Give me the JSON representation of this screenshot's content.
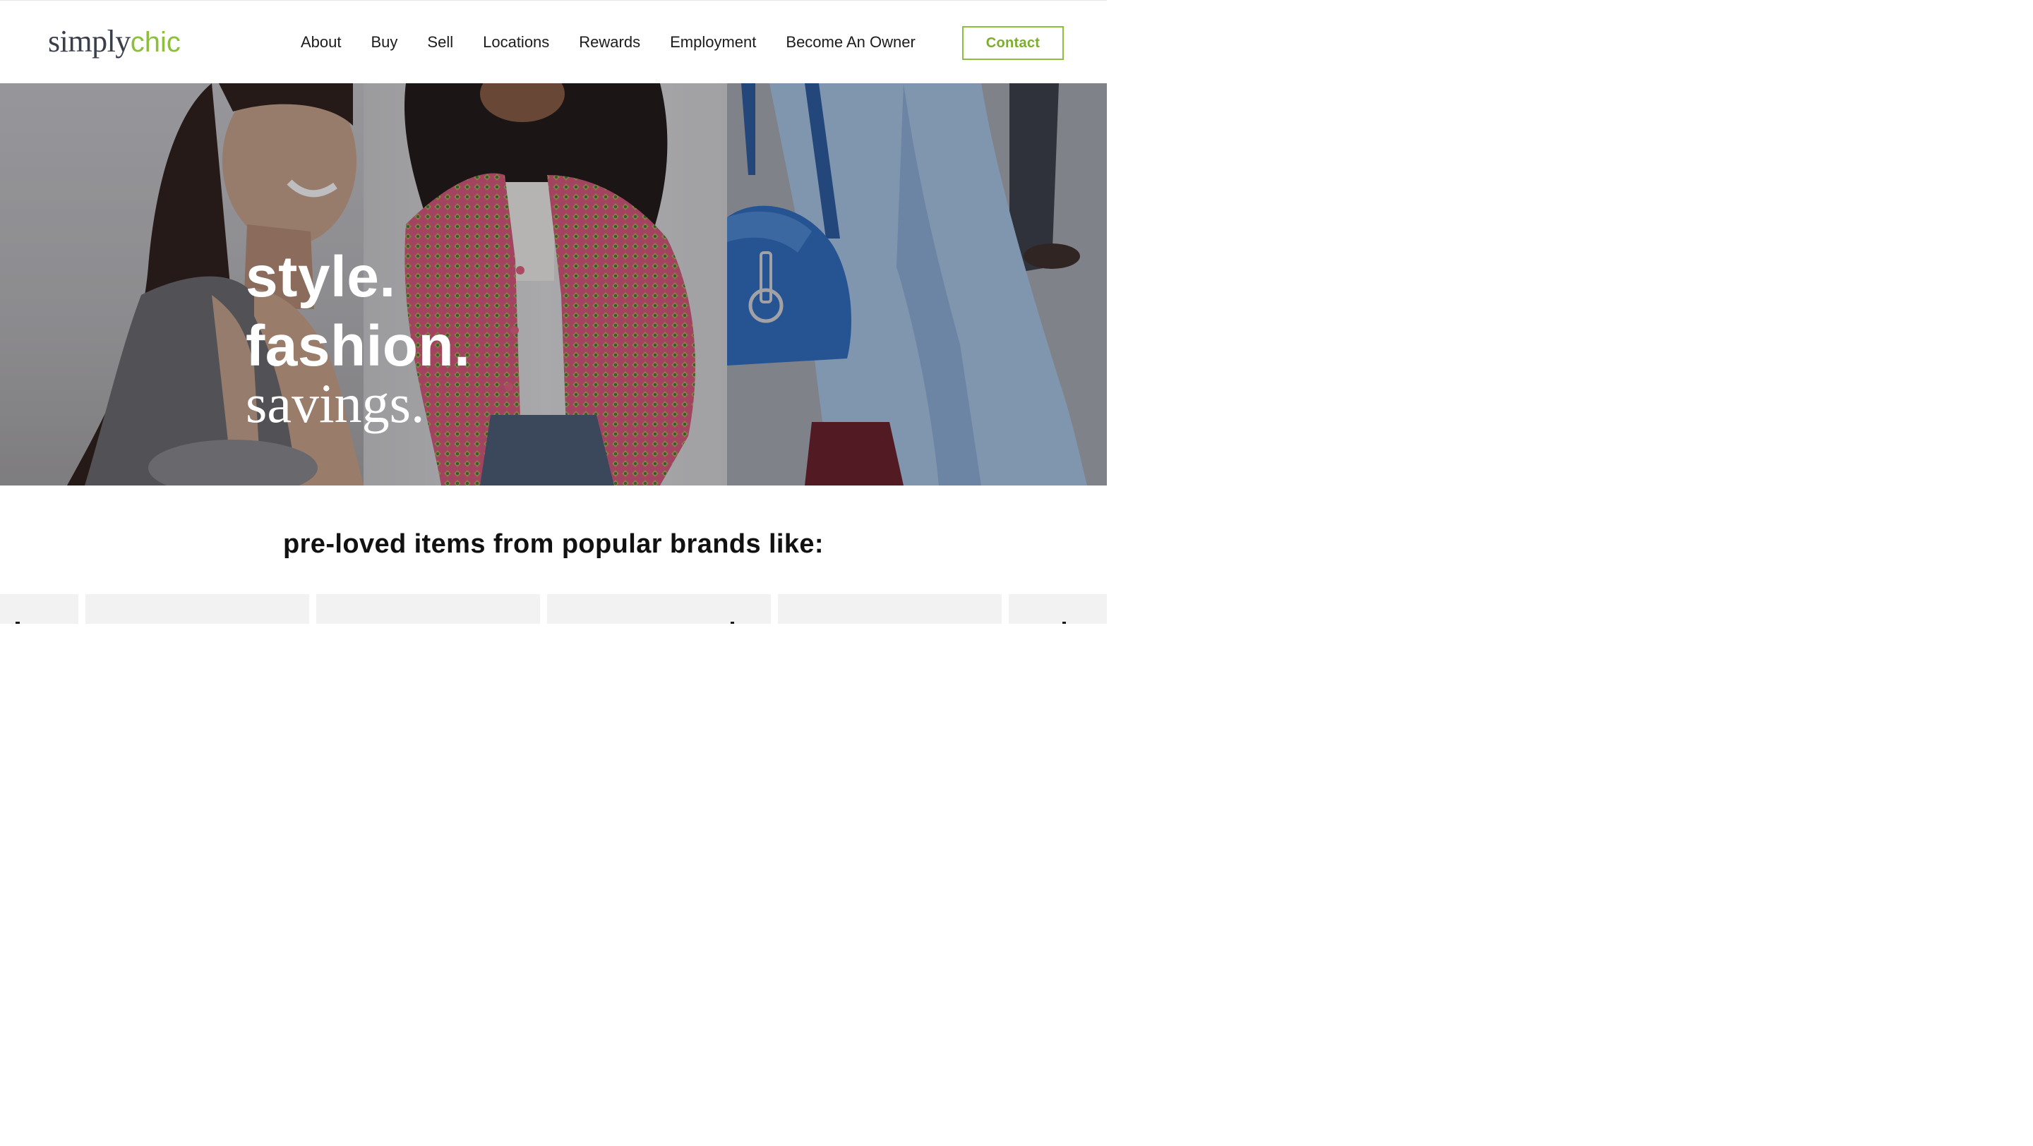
{
  "header": {
    "logo_part1": "simply",
    "logo_part2": "chic",
    "nav": [
      "About",
      "Buy",
      "Sell",
      "Locations",
      "Rewards",
      "Employment",
      "Become An Owner"
    ],
    "contact_label": "Contact"
  },
  "hero": {
    "line1": "style.",
    "line2": "fashion.",
    "line3": "savings."
  },
  "brands": {
    "heading": "pre-loved items from popular brands like:"
  },
  "colors": {
    "accent": "#8dbf3c",
    "text": "#1c1c1c",
    "tile": "#f2f2f2"
  }
}
